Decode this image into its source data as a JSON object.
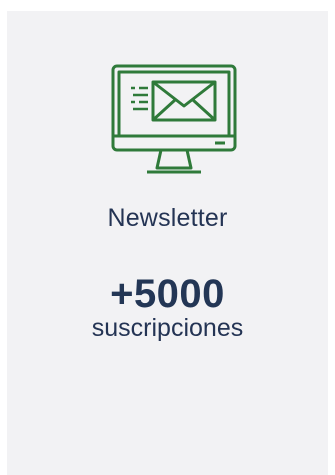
{
  "card": {
    "icon": "monitor-envelope-icon",
    "title": "Newsletter",
    "count": "+5000",
    "subtitle": "suscripciones"
  },
  "colors": {
    "card_bg": "#f2f2f4",
    "icon_green": "#2f7a3a",
    "text_navy": "#243454"
  }
}
